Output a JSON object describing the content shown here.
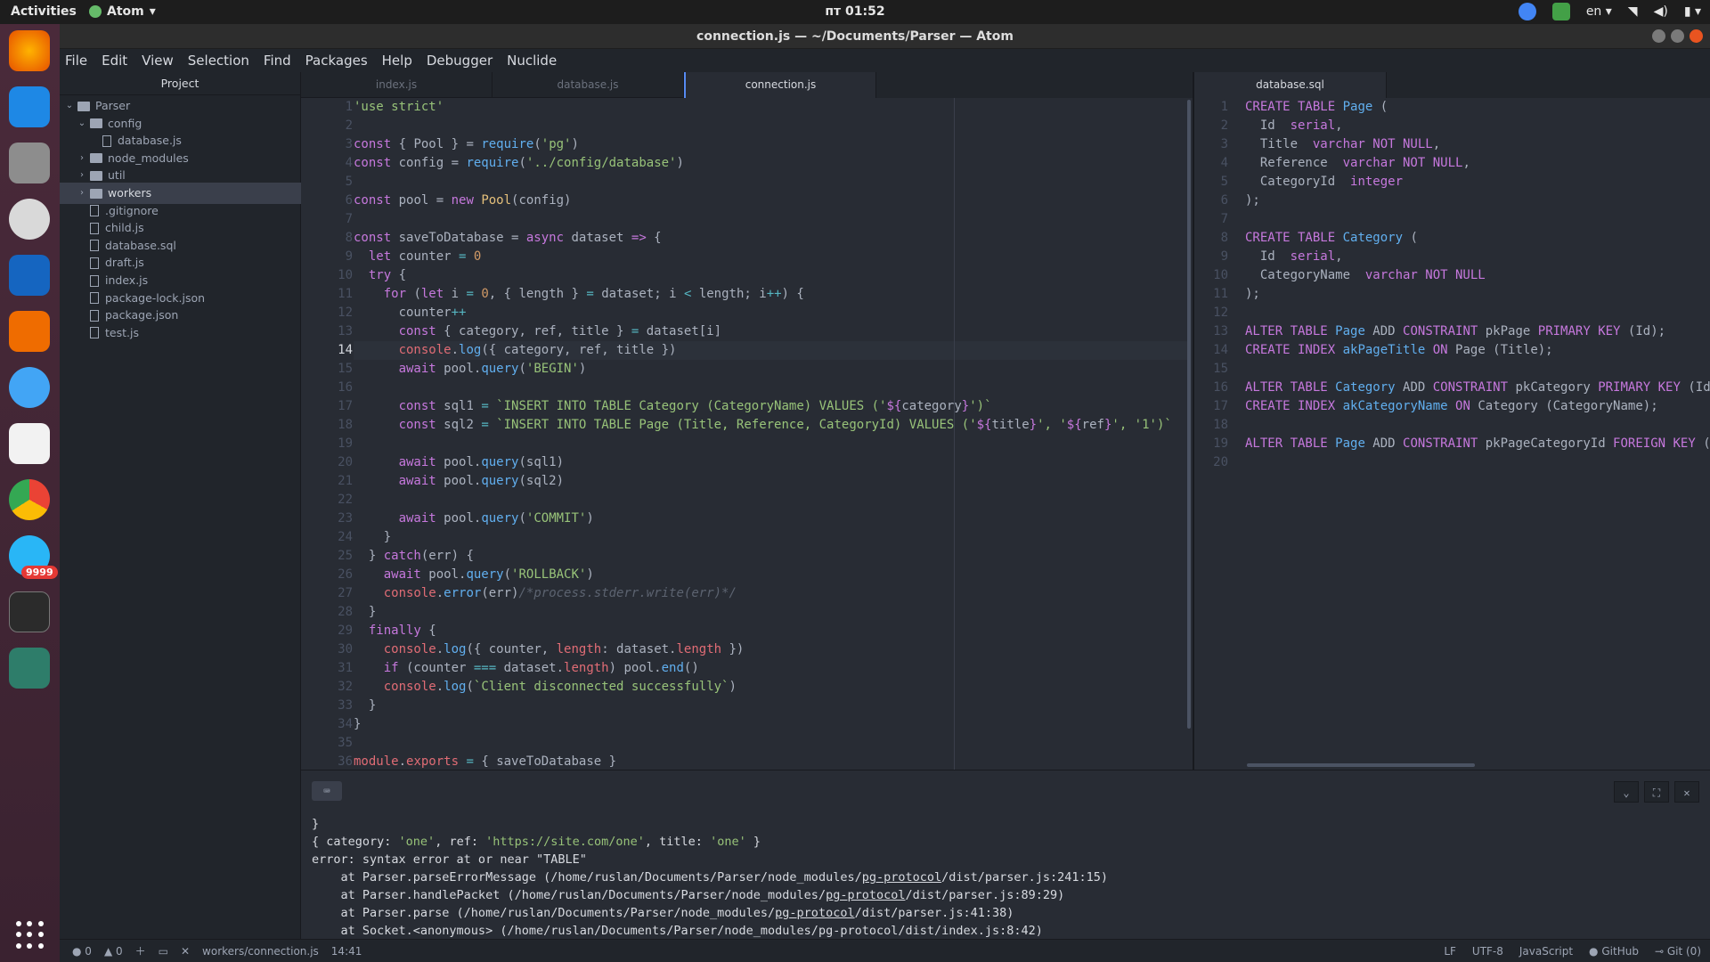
{
  "system": {
    "activities": "Activities",
    "app_menu": "Atom",
    "clock": "пт 01:52",
    "lang": "en",
    "notif_count": "9999"
  },
  "window": {
    "title": "connection.js — ~/Documents/Parser — Atom"
  },
  "menu": [
    "File",
    "Edit",
    "View",
    "Selection",
    "Find",
    "Packages",
    "Help",
    "Debugger",
    "Nuclide"
  ],
  "tree": {
    "header": "Project",
    "items": [
      {
        "label": "Parser",
        "kind": "folder",
        "chev": "⌄",
        "indent": 0
      },
      {
        "label": "config",
        "kind": "folder",
        "chev": "⌄",
        "indent": 1
      },
      {
        "label": "database.js",
        "kind": "file",
        "chev": "",
        "indent": 2
      },
      {
        "label": "node_modules",
        "kind": "folder",
        "chev": "›",
        "indent": 1
      },
      {
        "label": "util",
        "kind": "folder",
        "chev": "›",
        "indent": 1
      },
      {
        "label": "workers",
        "kind": "folder",
        "chev": "›",
        "indent": 1,
        "selected": true
      },
      {
        "label": ".gitignore",
        "kind": "file",
        "chev": "",
        "indent": 1
      },
      {
        "label": "child.js",
        "kind": "file",
        "chev": "",
        "indent": 1
      },
      {
        "label": "database.sql",
        "kind": "file",
        "chev": "",
        "indent": 1
      },
      {
        "label": "draft.js",
        "kind": "file",
        "chev": "",
        "indent": 1
      },
      {
        "label": "index.js",
        "kind": "file",
        "chev": "",
        "indent": 1
      },
      {
        "label": "package-lock.json",
        "kind": "file",
        "chev": "",
        "indent": 1
      },
      {
        "label": "package.json",
        "kind": "file",
        "chev": "",
        "indent": 1
      },
      {
        "label": "test.js",
        "kind": "file",
        "chev": "",
        "indent": 1
      }
    ]
  },
  "tabs_left": [
    "index.js",
    "database.js",
    "connection.js"
  ],
  "tabs_right": [
    "database.sql"
  ],
  "editor_left": {
    "cursor_line": 14,
    "lines": [
      [
        [
          "s",
          "'use strict'"
        ]
      ],
      [],
      [
        [
          "k",
          "const"
        ],
        [
          "p",
          " { Pool } = "
        ],
        [
          "f",
          "require"
        ],
        [
          "p",
          "("
        ],
        [
          "s",
          "'pg'"
        ],
        [
          "p",
          ")"
        ]
      ],
      [
        [
          "k",
          "const"
        ],
        [
          "p",
          " config = "
        ],
        [
          "f",
          "require"
        ],
        [
          "p",
          "("
        ],
        [
          "s",
          "'../config/database'"
        ],
        [
          "p",
          ")"
        ]
      ],
      [],
      [
        [
          "k",
          "const"
        ],
        [
          "p",
          " pool = "
        ],
        [
          "k",
          "new"
        ],
        [
          "p",
          " "
        ],
        [
          "y",
          "Pool"
        ],
        [
          "p",
          "(config)"
        ]
      ],
      [],
      [
        [
          "k",
          "const"
        ],
        [
          "p",
          " saveToDatabase = "
        ],
        [
          "k",
          "async"
        ],
        [
          "p",
          " dataset "
        ],
        [
          "k",
          "=>"
        ],
        [
          "p",
          " {"
        ]
      ],
      [
        [
          "p",
          "  "
        ],
        [
          "k",
          "let"
        ],
        [
          "p",
          " counter "
        ],
        [
          "o",
          "="
        ],
        [
          "p",
          " "
        ],
        [
          "n",
          "0"
        ]
      ],
      [
        [
          "p",
          "  "
        ],
        [
          "k",
          "try"
        ],
        [
          "p",
          " {"
        ]
      ],
      [
        [
          "p",
          "    "
        ],
        [
          "k",
          "for"
        ],
        [
          "p",
          " ("
        ],
        [
          "k",
          "let"
        ],
        [
          "p",
          " i "
        ],
        [
          "o",
          "="
        ],
        [
          "p",
          " "
        ],
        [
          "n",
          "0"
        ],
        [
          "p",
          ", { length } "
        ],
        [
          "o",
          "="
        ],
        [
          "p",
          " dataset; i "
        ],
        [
          "o",
          "<"
        ],
        [
          "p",
          " length; i"
        ],
        [
          "o",
          "++"
        ],
        [
          "p",
          ") {"
        ]
      ],
      [
        [
          "p",
          "      counter"
        ],
        [
          "o",
          "++"
        ]
      ],
      [
        [
          "p",
          "      "
        ],
        [
          "k",
          "const"
        ],
        [
          "p",
          " { category, ref, title } "
        ],
        [
          "o",
          "="
        ],
        [
          "p",
          " dataset[i]"
        ]
      ],
      [
        [
          "p",
          "      "
        ],
        [
          "r",
          "console"
        ],
        [
          "p",
          "."
        ],
        [
          "f",
          "log"
        ],
        [
          "p",
          "({ category, ref, title })"
        ]
      ],
      [
        [
          "p",
          "      "
        ],
        [
          "k",
          "await"
        ],
        [
          "p",
          " pool."
        ],
        [
          "f",
          "query"
        ],
        [
          "p",
          "("
        ],
        [
          "s",
          "'BEGIN'"
        ],
        [
          "p",
          ")"
        ]
      ],
      [],
      [
        [
          "p",
          "      "
        ],
        [
          "k",
          "const"
        ],
        [
          "p",
          " sql1 "
        ],
        [
          "o",
          "="
        ],
        [
          "p",
          " "
        ],
        [
          "s",
          "`INSERT INTO TABLE Category (CategoryName) VALUES ('"
        ],
        [
          "k",
          "${"
        ],
        [
          "p",
          "category"
        ],
        [
          "k",
          "}"
        ],
        [
          "s",
          "')`"
        ]
      ],
      [
        [
          "p",
          "      "
        ],
        [
          "k",
          "const"
        ],
        [
          "p",
          " sql2 "
        ],
        [
          "o",
          "="
        ],
        [
          "p",
          " "
        ],
        [
          "s",
          "`INSERT INTO TABLE Page (Title, Reference, CategoryId) VALUES ('"
        ],
        [
          "k",
          "${"
        ],
        [
          "p",
          "title"
        ],
        [
          "k",
          "}"
        ],
        [
          "s",
          "', '"
        ],
        [
          "k",
          "${"
        ],
        [
          "p",
          "ref"
        ],
        [
          "k",
          "}"
        ],
        [
          "s",
          "', '1')`"
        ]
      ],
      [],
      [
        [
          "p",
          "      "
        ],
        [
          "k",
          "await"
        ],
        [
          "p",
          " pool."
        ],
        [
          "f",
          "query"
        ],
        [
          "p",
          "(sql1)"
        ]
      ],
      [
        [
          "p",
          "      "
        ],
        [
          "k",
          "await"
        ],
        [
          "p",
          " pool."
        ],
        [
          "f",
          "query"
        ],
        [
          "p",
          "(sql2)"
        ]
      ],
      [],
      [
        [
          "p",
          "      "
        ],
        [
          "k",
          "await"
        ],
        [
          "p",
          " pool."
        ],
        [
          "f",
          "query"
        ],
        [
          "p",
          "("
        ],
        [
          "s",
          "'COMMIT'"
        ],
        [
          "p",
          ")"
        ]
      ],
      [
        [
          "p",
          "    }"
        ]
      ],
      [
        [
          "p",
          "  } "
        ],
        [
          "k",
          "catch"
        ],
        [
          "p",
          "(err) {"
        ]
      ],
      [
        [
          "p",
          "    "
        ],
        [
          "k",
          "await"
        ],
        [
          "p",
          " pool."
        ],
        [
          "f",
          "query"
        ],
        [
          "p",
          "("
        ],
        [
          "s",
          "'ROLLBACK'"
        ],
        [
          "p",
          ")"
        ]
      ],
      [
        [
          "p",
          "    "
        ],
        [
          "r",
          "console"
        ],
        [
          "p",
          "."
        ],
        [
          "f",
          "error"
        ],
        [
          "p",
          "(err)"
        ],
        [
          "c",
          "/*process.stderr.write(err)*/"
        ]
      ],
      [
        [
          "p",
          "  }"
        ]
      ],
      [
        [
          "p",
          "  "
        ],
        [
          "k",
          "finally"
        ],
        [
          "p",
          " {"
        ]
      ],
      [
        [
          "p",
          "    "
        ],
        [
          "r",
          "console"
        ],
        [
          "p",
          "."
        ],
        [
          "f",
          "log"
        ],
        [
          "p",
          "({ counter, "
        ],
        [
          "r",
          "length"
        ],
        [
          "p",
          ": dataset."
        ],
        [
          "r",
          "length"
        ],
        [
          "p",
          " })"
        ]
      ],
      [
        [
          "p",
          "    "
        ],
        [
          "k",
          "if"
        ],
        [
          "p",
          " (counter "
        ],
        [
          "o",
          "==="
        ],
        [
          "p",
          " dataset."
        ],
        [
          "r",
          "length"
        ],
        [
          "p",
          ") pool."
        ],
        [
          "f",
          "end"
        ],
        [
          "p",
          "()"
        ]
      ],
      [
        [
          "p",
          "    "
        ],
        [
          "r",
          "console"
        ],
        [
          "p",
          "."
        ],
        [
          "f",
          "log"
        ],
        [
          "p",
          "("
        ],
        [
          "s",
          "`Client disconnected successfully`"
        ],
        [
          "p",
          ")"
        ]
      ],
      [
        [
          "p",
          "  }"
        ]
      ],
      [
        [
          "p",
          "}"
        ]
      ],
      [],
      [
        [
          "r",
          "module"
        ],
        [
          "p",
          "."
        ],
        [
          "r",
          "exports"
        ],
        [
          "p",
          " "
        ],
        [
          "o",
          "="
        ],
        [
          "p",
          " { saveToDatabase }"
        ]
      ]
    ]
  },
  "editor_right": {
    "lines": [
      [
        [
          "k",
          "CREATE TABLE"
        ],
        [
          "p",
          " "
        ],
        [
          "f",
          "Page"
        ],
        [
          "p",
          " ("
        ]
      ],
      [
        [
          "p",
          "  Id  "
        ],
        [
          "k",
          "serial"
        ],
        [
          "p",
          ","
        ]
      ],
      [
        [
          "p",
          "  Title  "
        ],
        [
          "k",
          "varchar NOT NULL"
        ],
        [
          "p",
          ","
        ]
      ],
      [
        [
          "p",
          "  Reference  "
        ],
        [
          "k",
          "varchar NOT NULL"
        ],
        [
          "p",
          ","
        ]
      ],
      [
        [
          "p",
          "  CategoryId  "
        ],
        [
          "k",
          "integer"
        ]
      ],
      [
        [
          "p",
          ");"
        ]
      ],
      [],
      [
        [
          "k",
          "CREATE TABLE"
        ],
        [
          "p",
          " "
        ],
        [
          "f",
          "Category"
        ],
        [
          "p",
          " ("
        ]
      ],
      [
        [
          "p",
          "  Id  "
        ],
        [
          "k",
          "serial"
        ],
        [
          "p",
          ","
        ]
      ],
      [
        [
          "p",
          "  CategoryName  "
        ],
        [
          "k",
          "varchar NOT NULL"
        ]
      ],
      [
        [
          "p",
          ");"
        ]
      ],
      [],
      [
        [
          "k",
          "ALTER TABLE"
        ],
        [
          "p",
          " "
        ],
        [
          "f",
          "Page"
        ],
        [
          "p",
          " ADD "
        ],
        [
          "k",
          "CONSTRAINT"
        ],
        [
          "p",
          " pkPage "
        ],
        [
          "k",
          "PRIMARY KEY"
        ],
        [
          "p",
          " (Id);"
        ]
      ],
      [
        [
          "k",
          "CREATE INDEX"
        ],
        [
          "p",
          " "
        ],
        [
          "f",
          "akPageTitle"
        ],
        [
          "p",
          " "
        ],
        [
          "k",
          "ON"
        ],
        [
          "p",
          " Page (Title);"
        ]
      ],
      [],
      [
        [
          "k",
          "ALTER TABLE"
        ],
        [
          "p",
          " "
        ],
        [
          "f",
          "Category"
        ],
        [
          "p",
          " ADD "
        ],
        [
          "k",
          "CONSTRAINT"
        ],
        [
          "p",
          " pkCategory "
        ],
        [
          "k",
          "PRIMARY KEY"
        ],
        [
          "p",
          " (Id"
        ]
      ],
      [
        [
          "k",
          "CREATE INDEX"
        ],
        [
          "p",
          " "
        ],
        [
          "f",
          "akCategoryName"
        ],
        [
          "p",
          " "
        ],
        [
          "k",
          "ON"
        ],
        [
          "p",
          " Category (CategoryName);"
        ]
      ],
      [],
      [
        [
          "k",
          "ALTER TABLE"
        ],
        [
          "p",
          " "
        ],
        [
          "f",
          "Page"
        ],
        [
          "p",
          " ADD "
        ],
        [
          "k",
          "CONSTRAINT"
        ],
        [
          "p",
          " pkPageCategoryId "
        ],
        [
          "k",
          "FOREIGN KEY"
        ],
        [
          "p",
          " ("
        ]
      ],
      []
    ]
  },
  "terminal": {
    "lines": [
      [
        [
          "p",
          "}"
        ]
      ],
      [
        [
          "p",
          "{ category: "
        ],
        [
          "s",
          "'one'"
        ],
        [
          "p",
          ", ref: "
        ],
        [
          "s",
          "'https://site.com/one'"
        ],
        [
          "p",
          ", title: "
        ],
        [
          "s",
          "'one'"
        ],
        [
          "p",
          " }"
        ]
      ],
      [
        [
          "p",
          "error: syntax error at or near \"TABLE\""
        ]
      ],
      [
        [
          "p",
          "    at Parser.parseErrorMessage (/home/ruslan/Documents/Parser/node_modules/"
        ],
        [
          "u",
          "pg-protocol"
        ],
        [
          "p",
          "/dist/parser.js:241:15)"
        ]
      ],
      [
        [
          "p",
          "    at Parser.handlePacket (/home/ruslan/Documents/Parser/node_modules/"
        ],
        [
          "u",
          "pg-protocol"
        ],
        [
          "p",
          "/dist/parser.js:89:29)"
        ]
      ],
      [
        [
          "p",
          "    at Parser.parse (/home/ruslan/Documents/Parser/node_modules/"
        ],
        [
          "u",
          "pg-protocol"
        ],
        [
          "p",
          "/dist/parser.js:41:38)"
        ]
      ],
      [
        [
          "p",
          "    at Socket.<anonymous> (/home/ruslan/Documents/Parser/node_modules/pg-protocol/dist/index.js:8:42)"
        ]
      ]
    ]
  },
  "statusbar": {
    "errors": "0",
    "warnings": "0",
    "path": "workers/connection.js",
    "cursor": "14:41",
    "eol": "LF",
    "encoding": "UTF-8",
    "grammar": "JavaScript",
    "github": "GitHub",
    "git": "Git (0)"
  }
}
